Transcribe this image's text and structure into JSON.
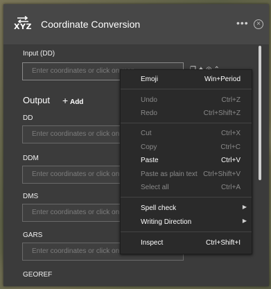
{
  "widget": {
    "title": "Coordinate Conversion",
    "logo_text": "XYZ"
  },
  "input": {
    "label": "Input (DD)",
    "placeholder": "Enter coordinates or click on map"
  },
  "output": {
    "title": "Output",
    "add_label": "Add",
    "fields": [
      {
        "label": "DD",
        "placeholder": "Enter coordinates or click on map"
      },
      {
        "label": "DDM",
        "placeholder": "Enter coordinates or click on map"
      },
      {
        "label": "DMS",
        "placeholder": "Enter coordinates or click on map"
      },
      {
        "label": "GARS",
        "placeholder": "Enter coordinates or click on map"
      },
      {
        "label": "GEOREF",
        "placeholder": ""
      }
    ]
  },
  "context_menu": {
    "items": [
      {
        "label": "Emoji",
        "shortcut": "Win+Period",
        "enabled": true
      },
      {
        "label": "Undo",
        "shortcut": "Ctrl+Z",
        "enabled": false
      },
      {
        "label": "Redo",
        "shortcut": "Ctrl+Shift+Z",
        "enabled": false
      },
      {
        "label": "Cut",
        "shortcut": "Ctrl+X",
        "enabled": false
      },
      {
        "label": "Copy",
        "shortcut": "Ctrl+C",
        "enabled": false
      },
      {
        "label": "Paste",
        "shortcut": "Ctrl+V",
        "enabled": true
      },
      {
        "label": "Paste as plain text",
        "shortcut": "Ctrl+Shift+V",
        "enabled": false
      },
      {
        "label": "Select all",
        "shortcut": "Ctrl+A",
        "enabled": false
      },
      {
        "label": "Spell check",
        "shortcut": "",
        "enabled": true
      },
      {
        "label": "Writing Direction",
        "shortcut": "",
        "enabled": true
      },
      {
        "label": "Inspect",
        "shortcut": "Ctrl+Shift+I",
        "enabled": true
      }
    ]
  },
  "icons": {
    "header": [
      "more-options-icon",
      "close-icon"
    ],
    "field_actions": [
      "copy-icon",
      "settings-icon",
      "close-icon",
      "chevron-right-icon"
    ]
  }
}
